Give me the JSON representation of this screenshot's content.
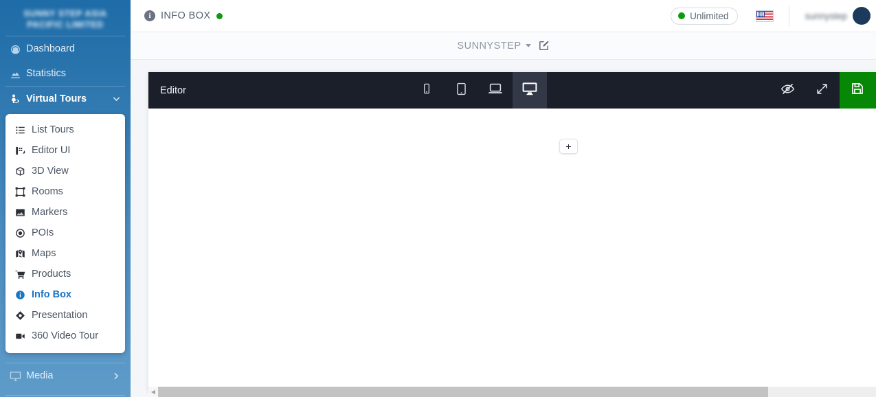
{
  "sidebar": {
    "logo": {
      "line1": "SUNNY STEP ASIA",
      "line2": "PACIFIC LIMITED"
    },
    "items": [
      {
        "label": "Dashboard",
        "icon": "gauge-icon"
      },
      {
        "label": "Statistics",
        "icon": "chart-area-icon"
      },
      {
        "label": "Virtual Tours",
        "icon": "street-view-icon",
        "active": true,
        "expanded": true
      },
      {
        "label": "Media",
        "icon": "desktop-icon"
      }
    ],
    "submenu": [
      {
        "label": "List Tours",
        "icon": "list-icon"
      },
      {
        "label": "Editor UI",
        "icon": "editor-ui-icon"
      },
      {
        "label": "3D View",
        "icon": "cube-icon"
      },
      {
        "label": "Rooms",
        "icon": "rooms-frame-icon"
      },
      {
        "label": "Markers",
        "icon": "marker-image-icon"
      },
      {
        "label": "POIs",
        "icon": "bullseye-icon"
      },
      {
        "label": "Maps",
        "icon": "map-marked-icon"
      },
      {
        "label": "Products",
        "icon": "cart-icon"
      },
      {
        "label": "Info Box",
        "icon": "info-circle-icon",
        "active": true
      },
      {
        "label": "Presentation",
        "icon": "diamond-icon"
      },
      {
        "label": "360 Video Tour",
        "icon": "video-camera-icon"
      }
    ]
  },
  "topbar": {
    "page_icon": "info-circle-icon",
    "page_title": "INFO BOX",
    "status_dot_color": "#119911",
    "plan": {
      "label": "Unlimited",
      "dot_color": "#0c9b0c"
    },
    "language_flag": "us-flag-icon",
    "user_name": "sunnystep",
    "avatar": "avatar"
  },
  "tourbar": {
    "tour_name": "SUNNYSTEP",
    "dropdown_icon": "caret-down-icon",
    "edit_icon": "pencil-square-icon"
  },
  "editor": {
    "title": "Editor",
    "devices": [
      {
        "name": "mobile",
        "icon": "mobile-icon",
        "active": false
      },
      {
        "name": "tablet",
        "icon": "tablet-icon",
        "active": false
      },
      {
        "name": "laptop",
        "icon": "laptop-icon",
        "active": false
      },
      {
        "name": "desktop",
        "icon": "desktop-icon",
        "active": true
      }
    ],
    "actions": [
      {
        "name": "toggle-preview",
        "icon": "eye-slash-icon"
      },
      {
        "name": "fullscreen",
        "icon": "expand-arrows-icon"
      }
    ],
    "save": {
      "icon": "floppy-save-icon",
      "color": "#068806"
    },
    "canvas": {
      "add_label": "+"
    }
  },
  "scrollbar": {
    "arrow_left_icon": "caret-left-icon"
  },
  "colors": {
    "sidebar_top": "#1e6ca8",
    "sidebar_bottom": "#5e9bc9",
    "toolbar_dark": "#1b1f2a",
    "toolbar_active": "#323846",
    "save_green": "#068806",
    "accent_blue": "#1a74c4"
  }
}
